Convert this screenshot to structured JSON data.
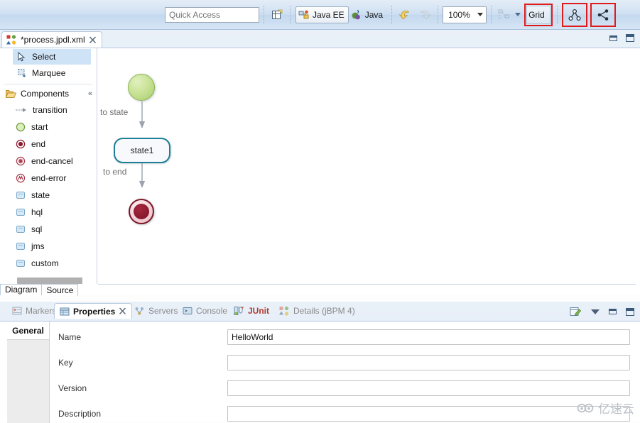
{
  "toolbar": {
    "quick_access_placeholder": "Quick Access",
    "new_wizard_icon": "new-wizard-icon",
    "perspectives": [
      {
        "label": "Java EE",
        "icon": "java-ee-perspective-icon",
        "active": true
      },
      {
        "label": "Java",
        "icon": "java-perspective-icon",
        "active": false
      }
    ],
    "undo_icon": "undo-arrow-icon",
    "redo_icon": "redo-arrow-icon",
    "zoom_level": "100%",
    "layout_icon": "auto-layout-icon",
    "grid_button_label": "Grid",
    "tree_layout_icon": "tree-layout-icon",
    "distribute_icon": "distribute-nodes-icon",
    "highlight_color": "#e01b1b"
  },
  "editor": {
    "tab_label": "*process.jpdl.xml",
    "tab_icon": "jpdl-process-icon",
    "close_icon": "close-icon",
    "minimize_icon": "minimize-icon",
    "maximize_icon": "maximize-icon",
    "bottom_tabs": [
      {
        "label": "Diagram",
        "active": true
      },
      {
        "label": "Source",
        "active": false
      }
    ]
  },
  "palette": {
    "tools": [
      {
        "label": "Select",
        "icon": "cursor-arrow-icon",
        "selected": true
      },
      {
        "label": "Marquee",
        "icon": "marquee-select-icon",
        "selected": false
      }
    ],
    "drawer": {
      "label": "Components",
      "icon": "open-folder-icon",
      "collapse_icon": "collapse-pin-icon"
    },
    "items": [
      {
        "label": "transition",
        "icon": "transition-arrow-icon",
        "color": "#9aa3ac"
      },
      {
        "label": "start",
        "icon": "start-node-icon",
        "color": "#a9cd6b"
      },
      {
        "label": "end",
        "icon": "end-node-icon",
        "color": "#8d1b2f"
      },
      {
        "label": "end-cancel",
        "icon": "end-cancel-node-icon",
        "color": "#a83a4c"
      },
      {
        "label": "end-error",
        "icon": "end-error-node-icon",
        "color": "#a83a4c"
      },
      {
        "label": "state",
        "icon": "state-node-icon",
        "color": "#9dc3e0"
      },
      {
        "label": "hql",
        "icon": "hql-node-icon",
        "color": "#9dc3e0"
      },
      {
        "label": "sql",
        "icon": "sql-node-icon",
        "color": "#9dc3e0"
      },
      {
        "label": "jms",
        "icon": "jms-node-icon",
        "color": "#9dc3e0"
      },
      {
        "label": "custom",
        "icon": "custom-node-icon",
        "color": "#9dc3e0"
      }
    ]
  },
  "diagram": {
    "nodes": [
      {
        "id": "start",
        "type": "start",
        "label": ""
      },
      {
        "id": "state1",
        "type": "state",
        "label": "state1"
      },
      {
        "id": "end",
        "type": "end",
        "label": ""
      }
    ],
    "transitions": [
      {
        "label": "to state",
        "from": "start",
        "to": "state1"
      },
      {
        "label": "to end",
        "from": "state1",
        "to": "end"
      }
    ],
    "state_border_color": "#1d7f95"
  },
  "properties": {
    "tabs": [
      {
        "label": "Markers",
        "icon": "markers-icon",
        "active": false
      },
      {
        "label": "Properties",
        "icon": "properties-icon",
        "active": true
      },
      {
        "label": "Servers",
        "icon": "servers-icon",
        "active": false
      },
      {
        "label": "Console",
        "icon": "console-icon",
        "active": false
      },
      {
        "label": "JUnit",
        "icon": "junit-icon",
        "active": false
      },
      {
        "label": "Details (jBPM 4)",
        "icon": "details-jbpm-icon",
        "active": false
      }
    ],
    "close_icon": "close-icon",
    "pin_icon": "pin-edit-icon",
    "view_menu_icon": "view-menu-icon",
    "minimize_icon": "minimize-icon",
    "maximize_icon": "maximize-icon",
    "rail": [
      {
        "label": "General",
        "active": true
      }
    ],
    "fields": [
      {
        "label": "Name",
        "value": "HelloWorld"
      },
      {
        "label": "Key",
        "value": ""
      },
      {
        "label": "Version",
        "value": ""
      },
      {
        "label": "Description",
        "value": ""
      }
    ]
  },
  "watermark": {
    "text": "亿速云"
  }
}
